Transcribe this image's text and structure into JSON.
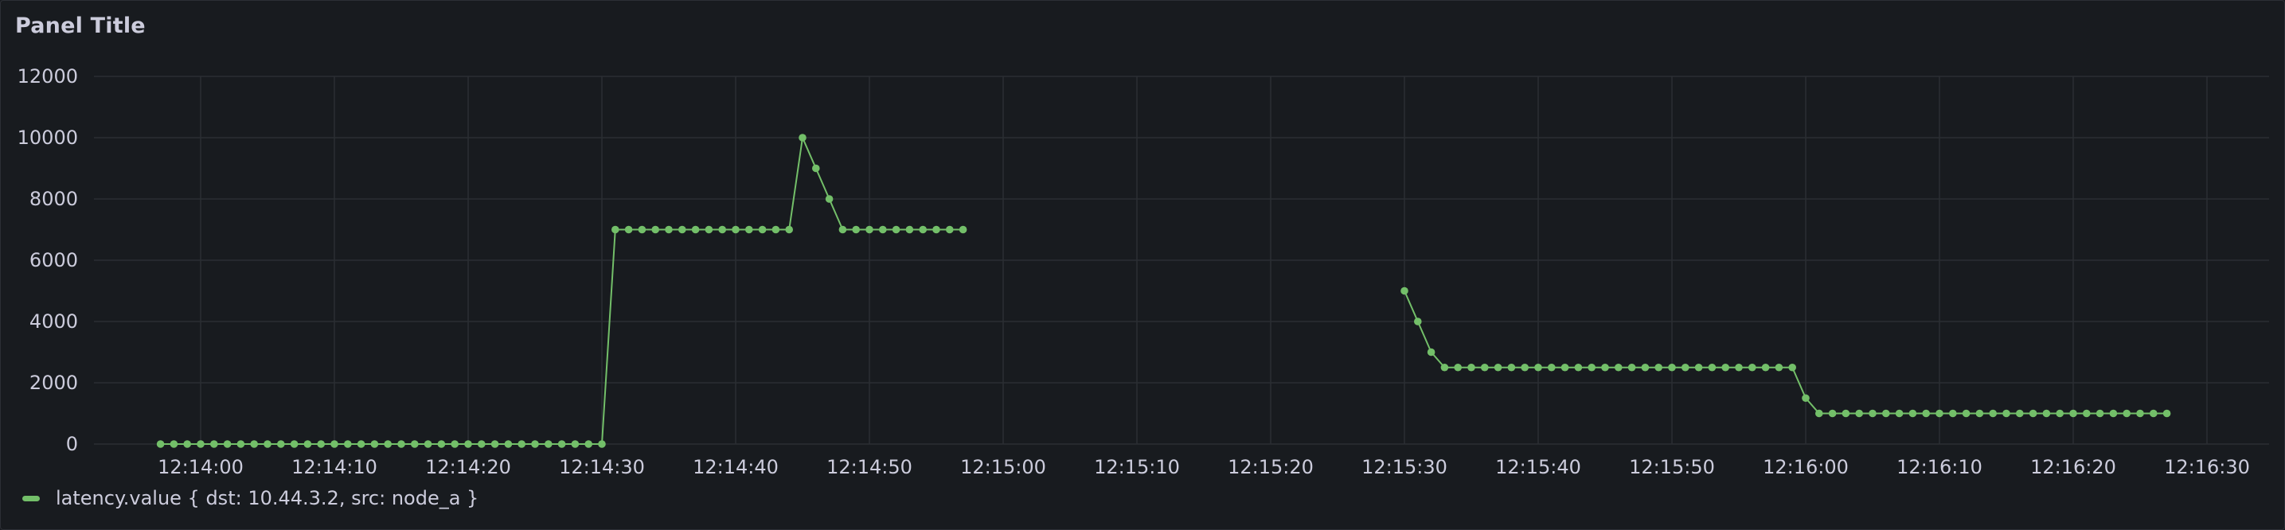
{
  "panel": {
    "title": "Panel Title"
  },
  "colors": {
    "series": "#73bf69",
    "grid": "#2b2e33",
    "text": "#ccccdc",
    "background": "#181b1f"
  },
  "chart_data": {
    "type": "line",
    "title": "Panel Title",
    "xlabel": "",
    "ylabel": "",
    "ylim": [
      0,
      12000
    ],
    "y_ticks": [
      0,
      2000,
      4000,
      6000,
      8000,
      10000,
      12000
    ],
    "x_ticks": [
      "12:14:00",
      "12:14:10",
      "12:14:20",
      "12:14:30",
      "12:14:40",
      "12:14:50",
      "12:15:00",
      "12:15:10",
      "12:15:20",
      "12:15:30",
      "12:15:40",
      "12:15:50",
      "12:16:00",
      "12:16:10",
      "12:16:20",
      "12:16:30"
    ],
    "grid": true,
    "legend": "bottom-left",
    "series": [
      {
        "name": "latency.value { dst: 10.44.3.2, src: node_a }",
        "color": "#73bf69",
        "segments": [
          {
            "start": "12:13:57",
            "values": [
              0,
              0,
              0,
              0,
              0,
              0,
              0,
              0,
              0,
              0,
              0,
              0,
              0,
              0,
              0,
              0,
              0,
              0,
              0,
              0,
              0,
              0,
              0,
              0,
              0,
              0,
              0,
              0,
              0,
              0,
              0,
              0,
              0,
              0,
              7000,
              7000,
              7000,
              7000,
              7000,
              7000,
              7000,
              7000,
              7000,
              7000,
              7000,
              7000,
              7000,
              7000,
              10000,
              9000,
              8000,
              7000,
              7000,
              7000,
              7000,
              7000,
              7000,
              7000,
              7000,
              7000,
              7000
            ]
          },
          {
            "start": "12:15:30",
            "values": [
              5000,
              4000,
              3000,
              2500,
              2500,
              2500,
              2500,
              2500,
              2500,
              2500,
              2500,
              2500,
              2500,
              2500,
              2500,
              2500,
              2500,
              2500,
              2500,
              2500,
              2500,
              2500,
              2500,
              2500,
              2500,
              2500,
              2500,
              2500,
              2500,
              2500,
              1500,
              1000,
              1000,
              1000,
              1000,
              1000,
              1000,
              1000,
              1000,
              1000,
              1000,
              1000,
              1000,
              1000,
              1000,
              1000,
              1000,
              1000,
              1000,
              1000,
              1000,
              1000,
              1000,
              1000,
              1000,
              1000,
              1000,
              1000
            ]
          }
        ]
      }
    ]
  }
}
